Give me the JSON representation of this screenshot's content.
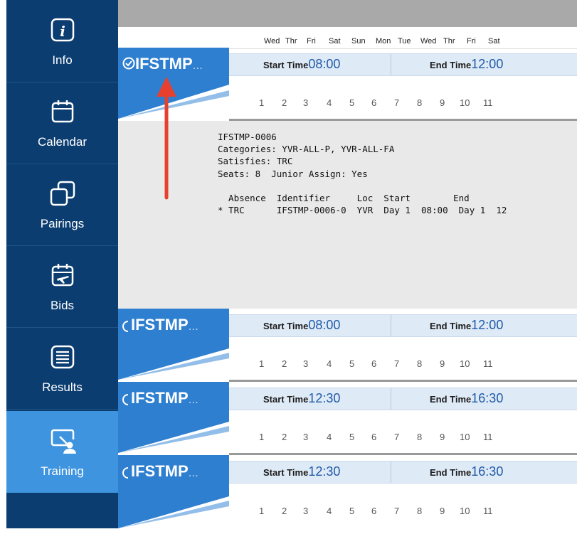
{
  "sidebar": {
    "items": [
      {
        "label": "Info",
        "icon": "info-icon",
        "active": false
      },
      {
        "label": "Calendar",
        "icon": "calendar-icon",
        "active": false
      },
      {
        "label": "Pairings",
        "icon": "pairings-icon",
        "active": false
      },
      {
        "label": "Bids",
        "icon": "bids-calendar-plane-icon",
        "active": false
      },
      {
        "label": "Results",
        "icon": "results-list-icon",
        "active": false
      },
      {
        "label": "Training",
        "icon": "training-presenter-icon",
        "active": true
      }
    ]
  },
  "calendar_header": {
    "days": [
      "Wed",
      "Thr",
      "Fri",
      "Sat",
      "Sun",
      "Mon",
      "Tue",
      "Wed",
      "Thr",
      "Fri",
      "Sat"
    ]
  },
  "day_numbers": [
    "1",
    "2",
    "3",
    "4",
    "5",
    "6",
    "7",
    "8",
    "9",
    "10",
    "11"
  ],
  "training_rows": [
    {
      "title": "IFSTMP",
      "ellipsis": "...",
      "selected": true,
      "start_label": "Start Time",
      "start_time": "08:00",
      "end_label": "End Time",
      "end_time": "12:00"
    },
    {
      "title": "IFSTMP",
      "ellipsis": "...",
      "selected": false,
      "start_label": "Start Time",
      "start_time": "08:00",
      "end_label": "End Time",
      "end_time": "12:00"
    },
    {
      "title": "IFSTMP",
      "ellipsis": "...",
      "selected": false,
      "start_label": "Start Time",
      "start_time": "12:30",
      "end_label": "End Time",
      "end_time": "16:30"
    },
    {
      "title": "IFSTMP",
      "ellipsis": "...",
      "selected": false,
      "start_label": "Start Time",
      "start_time": "12:30",
      "end_label": "End Time",
      "end_time": "16:30"
    }
  ],
  "detail": {
    "text": "IFSTMP-0006\nCategories: YVR-ALL-P, YVR-ALL-FA\nSatisfies: TRC\nSeats: 8  Junior Assign: Yes\n\n  Absence  Identifier     Loc  Start        End\n* TRC      IFSTMP-0006-0  YVR  Day 1  08:00  Day 1  12"
  },
  "colors": {
    "sidebar": "#0b3d70",
    "sidebar_active": "#3e94de",
    "tile_blue": "#2f7fd0",
    "time_value": "#1e5aa8",
    "annotation_arrow": "#e8402f"
  }
}
